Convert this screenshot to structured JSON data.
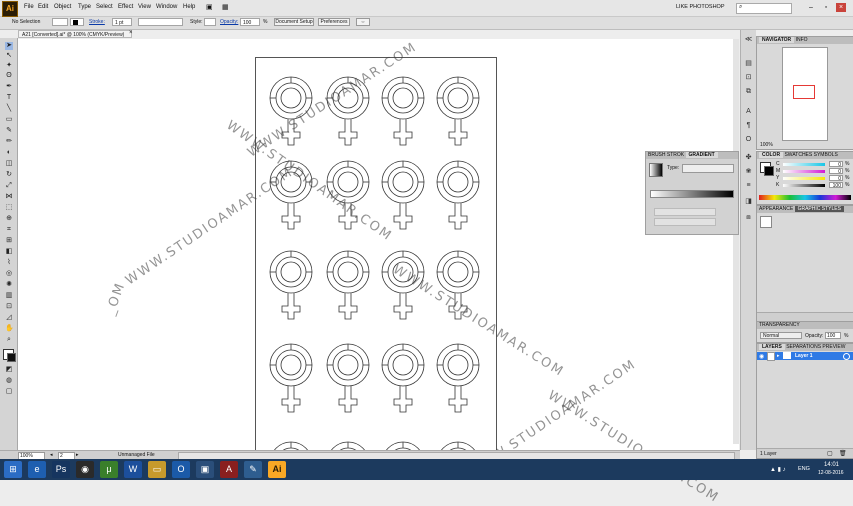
{
  "app": {
    "logo_text": "Ai",
    "menu": [
      "File",
      "Edit",
      "Object",
      "Type",
      "Select",
      "Effect",
      "View",
      "Window",
      "Help"
    ],
    "workspace": "LIKE PHOTOSHOP",
    "search_icon": "search-icon"
  },
  "control_bar": {
    "selection_label": "No Selection",
    "stroke_label": "Stroke:",
    "stroke_value": "1 pt",
    "style_label": "Style:",
    "opacity_label": "Opacity:",
    "opacity_value": "100",
    "opacity_unit": "%",
    "document_setup": "Document Setup",
    "preferences": "Preferences"
  },
  "document": {
    "tab_title": "A21 [Converted].ai* @ 100% (CMYK/Preview)",
    "zoom": "100%",
    "page_number": "2",
    "status": "Unmanaged File"
  },
  "watermarks": [
    "WWW.STUDIOAMAR.COM",
    "WWW.STUDIOAMAR.COM",
    "WWW.STUDIOAMAR.COM",
    "WWW.STUDIOAMAR.COM",
    "WWW.STUDIOAMAR.COM",
    "_OM"
  ],
  "navigator": {
    "tabs": [
      "NAVIGATOR",
      "INFO"
    ],
    "zoom": "100%"
  },
  "color_panel": {
    "tabs": [
      "COLOR",
      "SWATCHES",
      "SYMBOLS"
    ],
    "channels": [
      {
        "name": "C",
        "value": "0"
      },
      {
        "name": "M",
        "value": "0"
      },
      {
        "name": "Y",
        "value": "0"
      },
      {
        "name": "K",
        "value": "100"
      }
    ],
    "unit": "%"
  },
  "gradient_panel": {
    "tabs": [
      "BRUSH",
      "STROK",
      "GRADIENT"
    ],
    "type_label": "Type:"
  },
  "appearance_panel": {
    "tabs": [
      "APPEARANCE",
      "GRAPHIC STYLES"
    ]
  },
  "transparency_panel": {
    "title": "TRANSPARENCY",
    "blend_mode": "Normal",
    "opacity_label": "Opacity:",
    "opacity_value": "100",
    "unit": "%"
  },
  "layers_panel": {
    "tabs": [
      "LAYERS",
      "SEPARATIONS PREVIEW"
    ],
    "layers": [
      {
        "name": "Layer 1"
      }
    ],
    "count": "1 Layer"
  },
  "taskbar": {
    "apps": [
      "windows-start-icon",
      "ie-icon",
      "photoshop-icon",
      "chrome-icon",
      "utorrent-icon",
      "word-icon",
      "folder-icon",
      "outlook-icon",
      "media-icon",
      "acrobat-icon",
      "paint-icon",
      "illustrator-icon"
    ],
    "app_glyphs": [
      "⊞",
      "e",
      "Ps",
      "◉",
      "μ",
      "W",
      "▭",
      "O",
      "▣",
      "A",
      "✎",
      "Ai"
    ],
    "lang": "ENG",
    "time": "14:01",
    "date": "12-08-2016"
  },
  "colors": {
    "taskbar": "#1c3a5e",
    "ai_brand": "#f9a825",
    "selection_blue": "#2f7ae5"
  }
}
